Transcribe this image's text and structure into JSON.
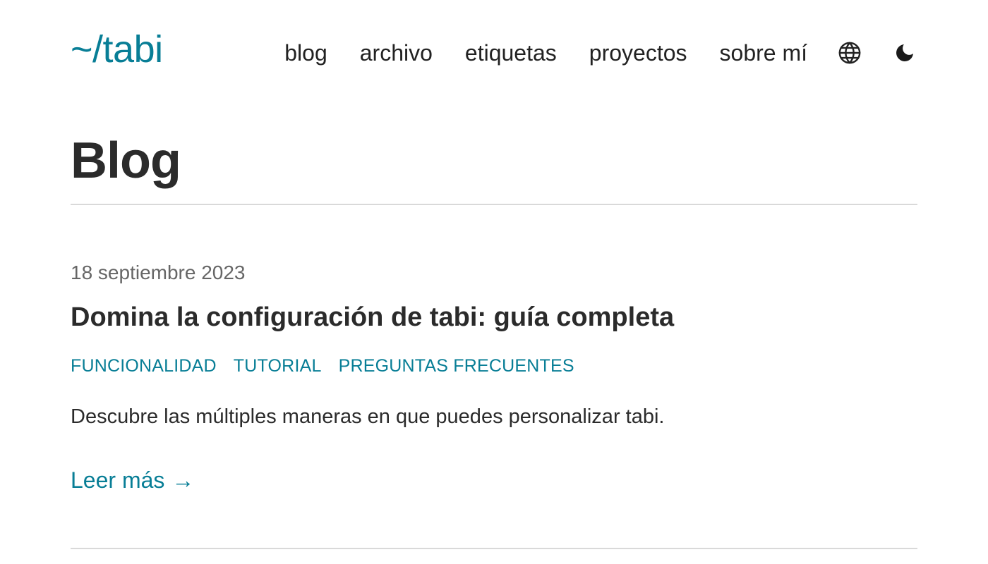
{
  "header": {
    "logo": "~/tabi",
    "nav": [
      {
        "label": "blog"
      },
      {
        "label": "archivo"
      },
      {
        "label": "etiquetas"
      },
      {
        "label": "proyectos"
      },
      {
        "label": "sobre mí"
      }
    ],
    "language_icon": "globe-icon",
    "theme_icon": "moon-icon"
  },
  "page": {
    "title": "Blog"
  },
  "post": {
    "date": "18 septiembre 2023",
    "title": "Domina la configuración de tabi: guía completa",
    "tags": [
      "funcionalidad",
      "tutorial",
      "preguntas frecuentes"
    ],
    "summary": "Descubre las múltiples maneras en que puedes personalizar tabi.",
    "read_more_label": "Leer más",
    "read_more_arrow": "→"
  },
  "colors": {
    "accent": "#087e96",
    "text": "#2b2b2b",
    "muted": "#666666",
    "divider": "#d9d9d9"
  }
}
